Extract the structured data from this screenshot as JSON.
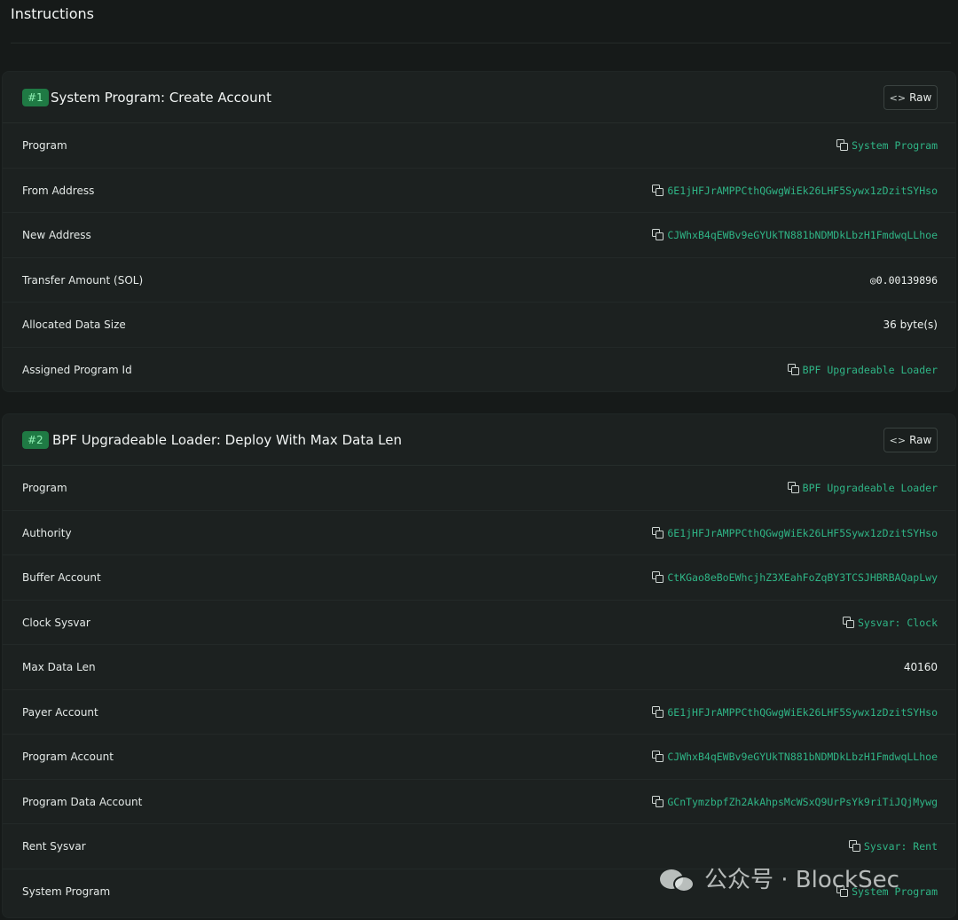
{
  "section": {
    "title": "Instructions"
  },
  "instructions": [
    {
      "badge": "#1",
      "title": "System Program: Create Account",
      "raw_label": "Raw",
      "rows": [
        {
          "label": "Program",
          "value": "System Program",
          "link": true
        },
        {
          "label": "From Address",
          "value": "6E1jHFJrAMPPCthQGwgWiEk26LHF5Sywx1zDzitSYHso",
          "link": true
        },
        {
          "label": "New Address",
          "value": "CJWhxB4qEWBv9eGYUkTN881bNDMDkLbzH1FmdwqLLhoe",
          "link": true
        },
        {
          "label": "Transfer Amount (SOL)",
          "value": "◎0.00139896",
          "link": false
        },
        {
          "label": "Allocated Data Size",
          "value": "36 byte(s)",
          "link": false
        },
        {
          "label": "Assigned Program Id",
          "value": "BPF Upgradeable Loader",
          "link": true
        }
      ]
    },
    {
      "badge": "#2",
      "title": "BPF Upgradeable Loader: Deploy With Max Data Len",
      "raw_label": "Raw",
      "rows": [
        {
          "label": "Program",
          "value": "BPF Upgradeable Loader",
          "link": true
        },
        {
          "label": "Authority",
          "value": "6E1jHFJrAMPPCthQGwgWiEk26LHF5Sywx1zDzitSYHso",
          "link": true
        },
        {
          "label": "Buffer Account",
          "value": "CtKGao8eBoEWhcjhZ3XEahFoZqBY3TCSJHBRBAQapLwy",
          "link": true
        },
        {
          "label": "Clock Sysvar",
          "value": "Sysvar: Clock",
          "link": true
        },
        {
          "label": "Max Data Len",
          "value": "40160",
          "link": false
        },
        {
          "label": "Payer Account",
          "value": "6E1jHFJrAMPPCthQGwgWiEk26LHF5Sywx1zDzitSYHso",
          "link": true
        },
        {
          "label": "Program Account",
          "value": "CJWhxB4qEWBv9eGYUkTN881bNDMDkLbzH1FmdwqLLhoe",
          "link": true
        },
        {
          "label": "Program Data Account",
          "value": "GCnTymzbpfZh2AkAhpsMcWSxQ9UrPsYk9riTiJQjMywg",
          "link": true
        },
        {
          "label": "Rent Sysvar",
          "value": "Sysvar: Rent",
          "link": true
        },
        {
          "label": "System Program",
          "value": "System Program",
          "link": true
        }
      ]
    }
  ],
  "watermark": {
    "text": "公众号 · BlockSec"
  },
  "colors": {
    "link": "#2fb586",
    "badge_bg": "#1f7a44",
    "card_bg": "#1c2120",
    "page_bg": "#161a19"
  }
}
